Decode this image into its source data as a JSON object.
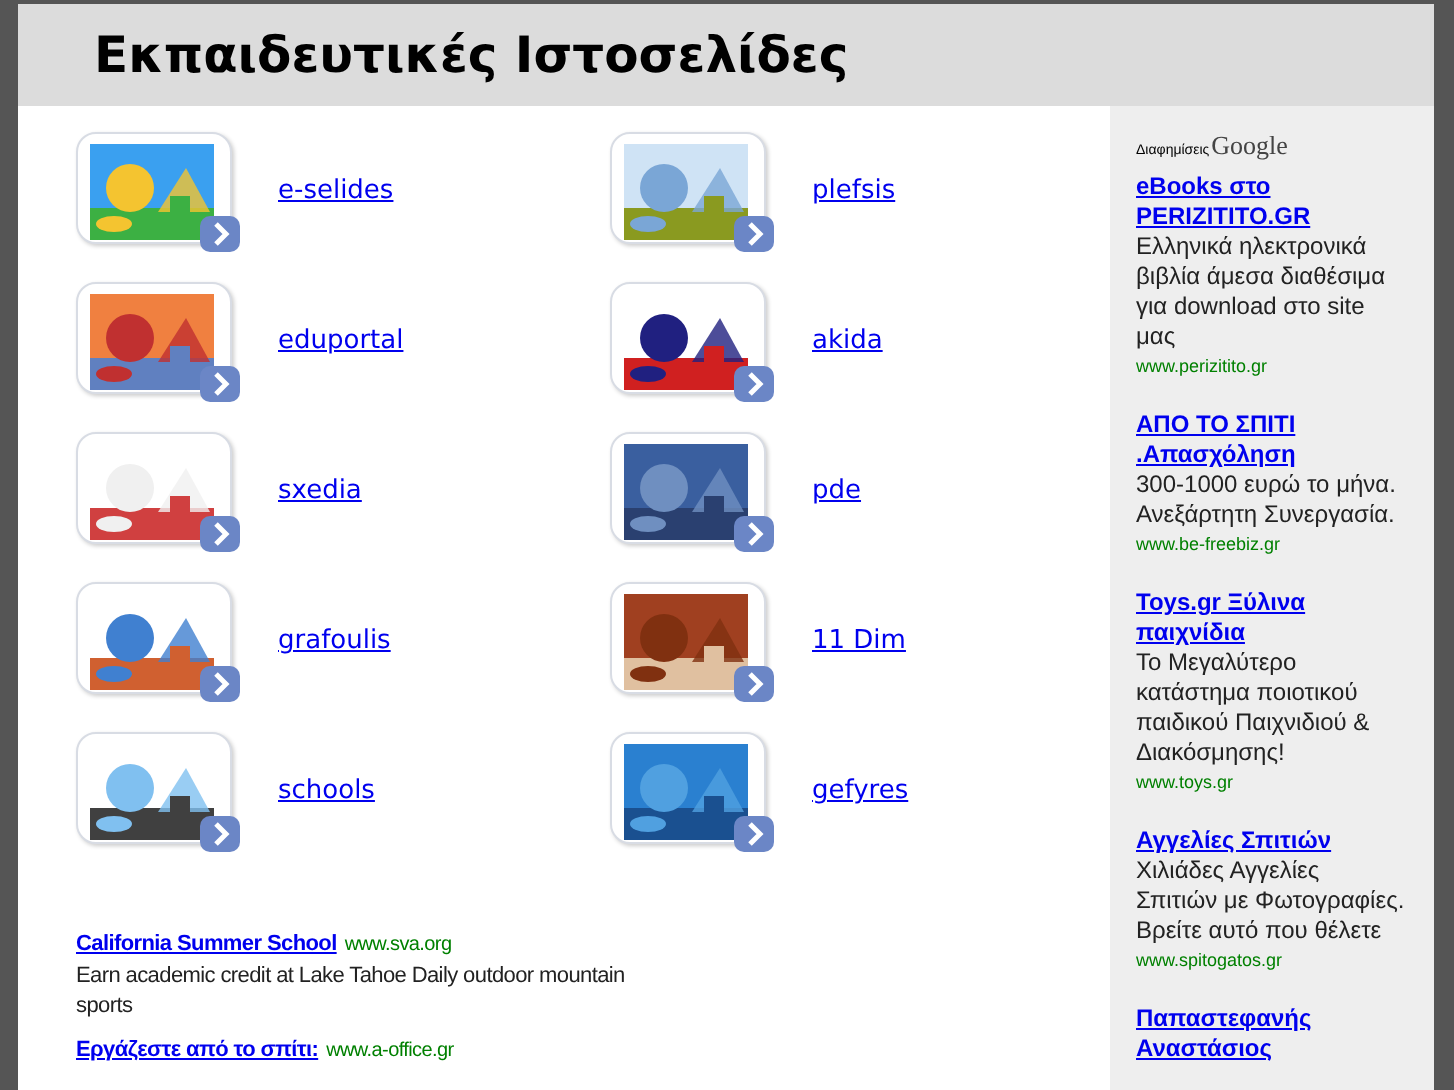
{
  "header": {
    "title": "Εκπαιδευτικές Ιστοσελίδες"
  },
  "sites": [
    {
      "label": "e-selides"
    },
    {
      "label": "plefsis"
    },
    {
      "label": "eduportal"
    },
    {
      "label": "akida"
    },
    {
      "label": "sxedia"
    },
    {
      "label": "pde"
    },
    {
      "label": "grafoulis"
    },
    {
      "label": "11 Dim"
    },
    {
      "label": "schools"
    },
    {
      "label": "gefyres"
    }
  ],
  "bottom_ads": [
    {
      "title": "California Summer School",
      "url": "www.sva.org",
      "text": "Earn academic credit at Lake Tahoe Daily outdoor mountain sports"
    },
    {
      "title": "Εργάζεστε από το σπίτι:",
      "url": "www.a-office.gr"
    }
  ],
  "sidebar": {
    "label": "Διαφημίσεις",
    "brand": "Google",
    "ads": [
      {
        "title": "eBooks στο PERIZITITO.GR",
        "text": "Ελληνικά ηλεκτρονικά βιβλία άμεσα διαθέσιμα για download στο site μας",
        "url": "www.perizitito.gr"
      },
      {
        "title": "ΑΠΟ ΤΟ ΣΠΙΤΙ .Απασχόληση",
        "text": "300-1000 ευρώ το μήνα. Ανεξάρτητη Συνεργασία.",
        "url": "www.be-freebiz.gr"
      },
      {
        "title": "Toys.gr Ξύλινα παιχνίδια",
        "text": "Το Μεγαλύτερο κατάστημα ποιοτικού παιδικού Παιχνιδιού & Διακόσμησης!",
        "url": "www.toys.gr"
      },
      {
        "title": "Αγγελίες Σπιτιών",
        "text": "Χιλιάδες Αγγελίες Σπιτιών με Φωτογραφίες. Βρείτε αυτό που θέλετε",
        "url": "www.spitogatos.gr"
      },
      {
        "title": "Παπαστεφανής Αναστάσιος"
      }
    ]
  }
}
